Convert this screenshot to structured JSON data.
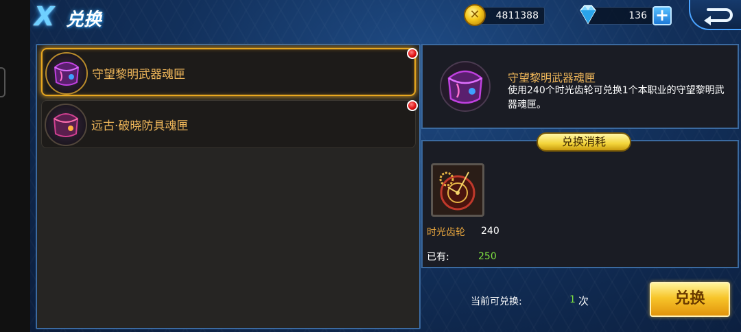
{
  "header": {
    "title_glyph": "X",
    "title": "兑换",
    "gold_icon_glyph": "✕",
    "gold": "4811388",
    "diamonds": "136",
    "plus_glyph": "+"
  },
  "items": [
    {
      "label": "守望黎明武器魂匣",
      "selected": true
    },
    {
      "label": "远古·破晓防具魂匣",
      "selected": false
    }
  ],
  "detail": {
    "name": "守望黎明武器魂匣",
    "description": "使用240个时光齿轮可兑换1个本职业的守望黎明武器魂匣。"
  },
  "cost": {
    "tab_label": "兑换消耗",
    "material_name": "时光齿轮",
    "material_required": "240",
    "owned_label": "已有:",
    "owned_value": "250"
  },
  "footer": {
    "available_label": "当前可兑换:",
    "available_count": "1",
    "available_unit": "次",
    "exchange_button": "兑换"
  },
  "colors": {
    "accent_gold": "#f0b75a",
    "positive_green": "#7de040",
    "frame_blue": "#3b6aa0"
  },
  "icons": {
    "gold": "gold-coin-icon",
    "diamond": "diamond-icon",
    "add": "plus-icon",
    "back": "back-arrow-icon",
    "item": "soul-box-icon",
    "material": "time-gear-icon"
  }
}
